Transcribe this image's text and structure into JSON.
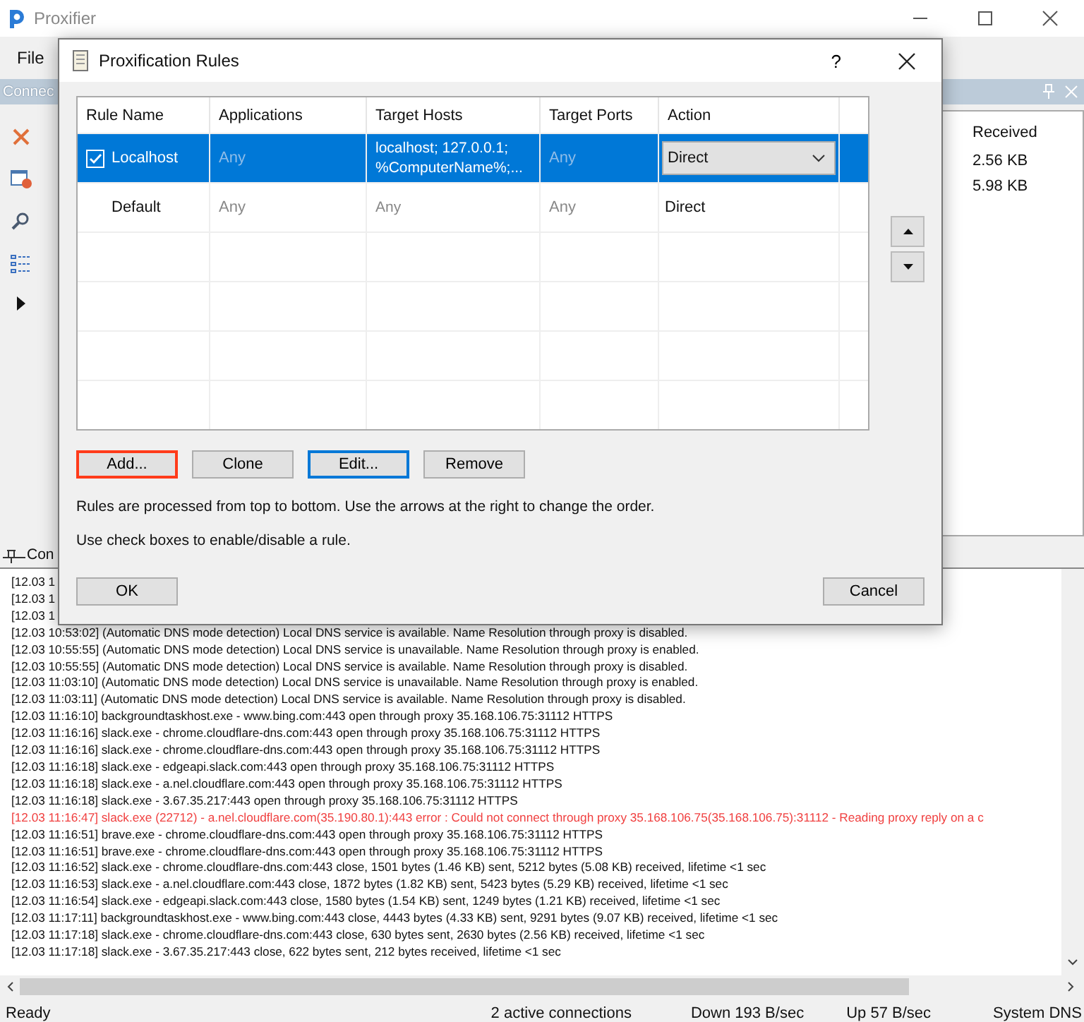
{
  "app_window": {
    "title": "Proxifier",
    "menu": [
      "File"
    ],
    "connections_panel": {
      "tab": "Connec",
      "columns": [
        "Received"
      ],
      "rows": [
        {
          "received": "2.56 KB"
        },
        {
          "received": "5.98 KB"
        }
      ]
    },
    "log_panel": {
      "tab": "Con",
      "lines": [
        {
          "kind": "info",
          "text": "[12.03 1"
        },
        {
          "kind": "info",
          "text": "[12.03 1"
        },
        {
          "kind": "info",
          "text": "[12.03 1"
        },
        {
          "kind": "info",
          "text": "[12.03 10:53:02] (Automatic DNS mode detection) Local DNS service is available. Name Resolution through proxy is disabled."
        },
        {
          "kind": "info",
          "text": "[12.03 10:55:55] (Automatic DNS mode detection) Local DNS service is unavailable. Name Resolution through proxy is enabled."
        },
        {
          "kind": "info",
          "text": "[12.03 10:55:55] (Automatic DNS mode detection) Local DNS service is available. Name Resolution through proxy is disabled."
        },
        {
          "kind": "info",
          "text": "[12.03 11:03:10] (Automatic DNS mode detection) Local DNS service is unavailable. Name Resolution through proxy is enabled."
        },
        {
          "kind": "info",
          "text": "[12.03 11:03:11] (Automatic DNS mode detection) Local DNS service is available. Name Resolution through proxy is disabled."
        },
        {
          "kind": "info",
          "text": "[12.03 11:16:10] backgroundtaskhost.exe - www.bing.com:443 open through proxy 35.168.106.75:31112 HTTPS"
        },
        {
          "kind": "info",
          "text": "[12.03 11:16:16] slack.exe - chrome.cloudflare-dns.com:443 open through proxy 35.168.106.75:31112 HTTPS"
        },
        {
          "kind": "info",
          "text": "[12.03 11:16:16] slack.exe - chrome.cloudflare-dns.com:443 open through proxy 35.168.106.75:31112 HTTPS"
        },
        {
          "kind": "info",
          "text": "[12.03 11:16:18] slack.exe - edgeapi.slack.com:443 open through proxy 35.168.106.75:31112 HTTPS"
        },
        {
          "kind": "info",
          "text": "[12.03 11:16:18] slack.exe - a.nel.cloudflare.com:443 open through proxy 35.168.106.75:31112 HTTPS"
        },
        {
          "kind": "info",
          "text": "[12.03 11:16:18] slack.exe - 3.67.35.217:443 open through proxy 35.168.106.75:31112 HTTPS"
        },
        {
          "kind": "error",
          "text": "[12.03 11:16:47] slack.exe (22712) - a.nel.cloudflare.com(35.190.80.1):443 error : Could not connect through proxy 35.168.106.75(35.168.106.75):31112 - Reading proxy reply on a c"
        },
        {
          "kind": "info",
          "text": "[12.03 11:16:51] brave.exe - chrome.cloudflare-dns.com:443 open through proxy 35.168.106.75:31112 HTTPS"
        },
        {
          "kind": "info",
          "text": "[12.03 11:16:51] brave.exe - chrome.cloudflare-dns.com:443 open through proxy 35.168.106.75:31112 HTTPS"
        },
        {
          "kind": "info",
          "text": "[12.03 11:16:52] slack.exe - chrome.cloudflare-dns.com:443 close, 1501 bytes (1.46 KB) sent, 5212 bytes (5.08 KB) received, lifetime <1 sec"
        },
        {
          "kind": "info",
          "text": "[12.03 11:16:53] slack.exe - a.nel.cloudflare.com:443 close, 1872 bytes (1.82 KB) sent, 5423 bytes (5.29 KB) received, lifetime <1 sec"
        },
        {
          "kind": "info",
          "text": "[12.03 11:16:54] slack.exe - edgeapi.slack.com:443 close, 1580 bytes (1.54 KB) sent, 1249 bytes (1.21 KB) received, lifetime <1 sec"
        },
        {
          "kind": "info",
          "text": "[12.03 11:17:11] backgroundtaskhost.exe - www.bing.com:443 close, 4443 bytes (4.33 KB) sent, 9291 bytes (9.07 KB) received, lifetime <1 sec"
        },
        {
          "kind": "info",
          "text": "[12.03 11:17:18] slack.exe - chrome.cloudflare-dns.com:443 close, 630 bytes sent, 2630 bytes (2.56 KB) received, lifetime <1 sec"
        },
        {
          "kind": "info",
          "text": "[12.03 11:17:18] slack.exe - 3.67.35.217:443 close, 622 bytes sent, 212 bytes received, lifetime <1 sec"
        }
      ]
    },
    "status_bar": [
      "Ready",
      "2 active connections",
      "Down 193 B/sec",
      "Up 57 B/sec",
      "System DNS"
    ]
  },
  "dialog": {
    "title": "Proxification Rules",
    "help": "?",
    "columns": [
      "Rule Name",
      "Applications",
      "Target Hosts",
      "Target Ports",
      "Action"
    ],
    "rules": [
      {
        "name": "Localhost",
        "checked": true,
        "selected": true,
        "applications": "Any",
        "target_hosts": [
          "localhost; 127.0.0.1;",
          "%ComputerName%;..."
        ],
        "target_ports": "Any",
        "action": "Direct"
      },
      {
        "name": "Default",
        "selected": false,
        "applications": "Any",
        "target_hosts": [
          "Any"
        ],
        "target_ports": "Any",
        "action": "Direct"
      }
    ],
    "buttons": [
      {
        "label": "Add...",
        "highlighted": true,
        "focused": false
      },
      {
        "label": "Clone",
        "highlighted": false,
        "focused": false
      },
      {
        "label": "Edit...",
        "highlighted": false,
        "focused": true
      },
      {
        "label": "Remove",
        "highlighted": false,
        "focused": false
      }
    ],
    "notes": [
      "Rules are processed from top to bottom. Use the arrows at the right to change the order.",
      "Use check boxes to enable/disable a rule."
    ],
    "ok": "OK",
    "cancel": "Cancel"
  }
}
